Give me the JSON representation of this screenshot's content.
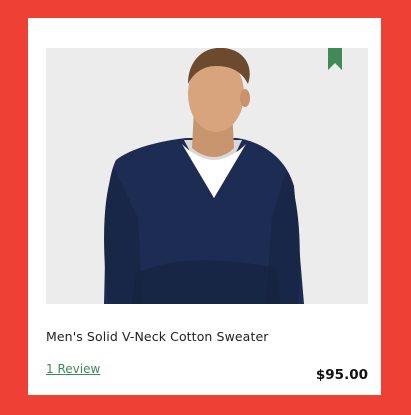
{
  "product": {
    "name": "Men's Solid V-Neck Cotton Sweater",
    "review_link": "1 Review",
    "price": "$95.00"
  },
  "colors": {
    "page_background": "#ee4035",
    "card_background": "#ffffff",
    "image_background": "#ececec",
    "bookmark": "#3f8a55",
    "review_link": "#3f8a55",
    "sweater": "#1c2c52"
  },
  "icons": {
    "bookmark": "bookmark-icon"
  }
}
